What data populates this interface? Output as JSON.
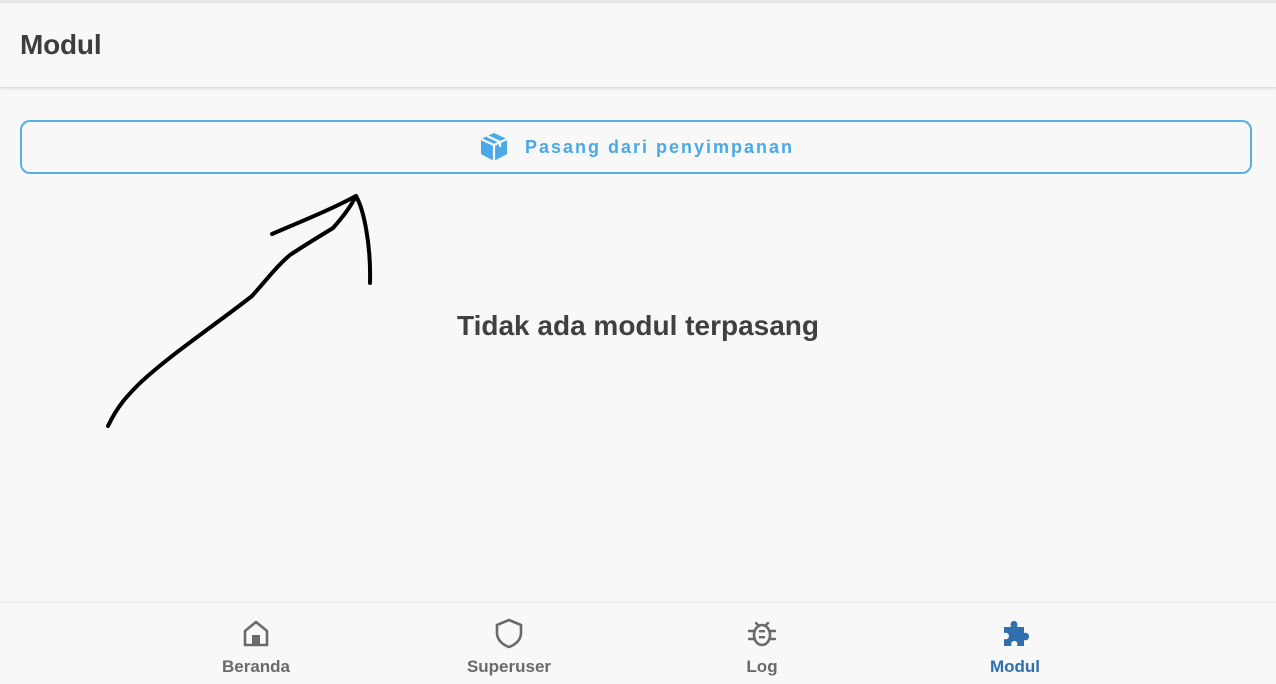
{
  "appbar": {
    "title": "Modul"
  },
  "install_button": {
    "label": "Pasang dari penyimpanan",
    "icon": "package-box-icon",
    "accent": "#4aa9e6"
  },
  "empty_state": {
    "message": "Tidak ada modul terpasang"
  },
  "bottom_nav": {
    "items": [
      {
        "label": "Beranda",
        "icon": "home-icon",
        "active": false
      },
      {
        "label": "Superuser",
        "icon": "shield-icon",
        "active": false
      },
      {
        "label": "Log",
        "icon": "bug-icon",
        "active": false
      },
      {
        "label": "Modul",
        "icon": "puzzle-icon",
        "active": true
      }
    ],
    "active_color": "#2f6fad",
    "inactive_color": "#6a6a6a"
  }
}
